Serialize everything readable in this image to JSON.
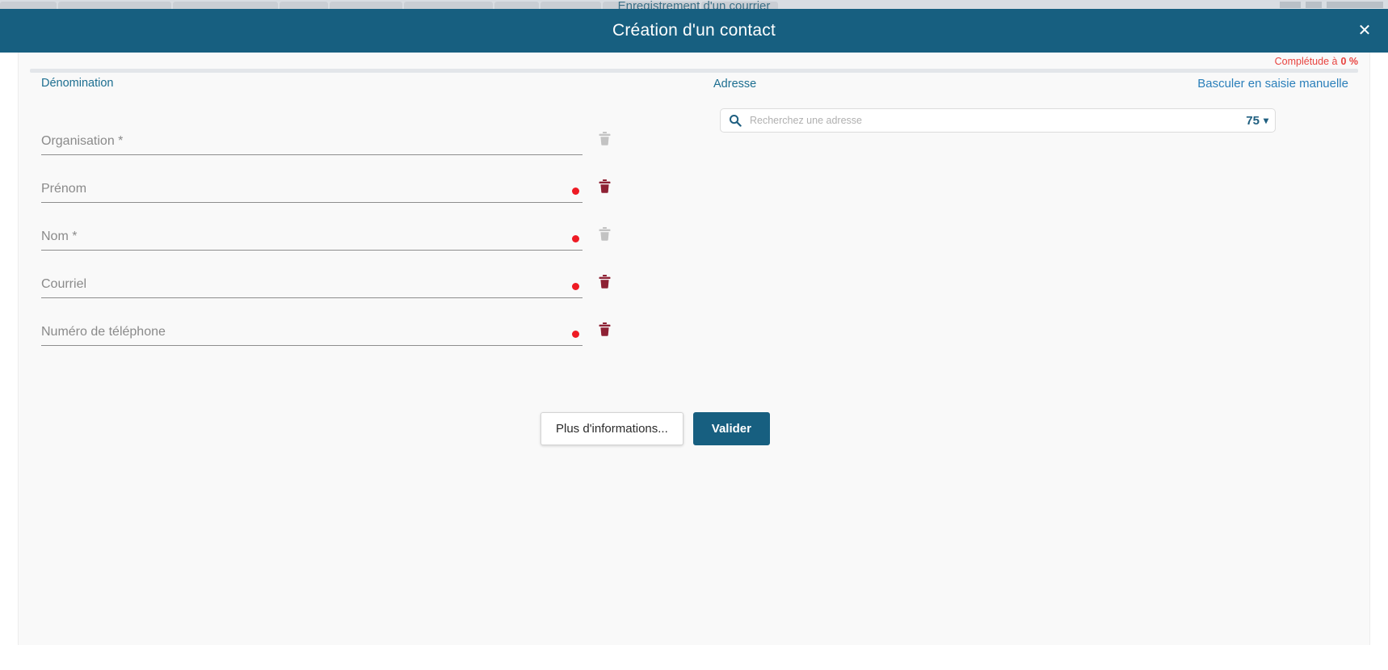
{
  "background": {
    "page_title": "Enregistrement d'un courrier",
    "tab_widths": [
      70,
      140,
      130,
      60,
      90,
      110,
      55,
      75,
      120,
      95
    ],
    "right_chip_widths": [
      26,
      20,
      70
    ]
  },
  "modal": {
    "title": "Création d'un contact",
    "close_icon": "close-icon",
    "close_label": "✕"
  },
  "completeness": {
    "prefix": "Complétude à",
    "value": "0 %",
    "percent": 0,
    "color": "#e8433f"
  },
  "denomination": {
    "section_label": "Dénomination",
    "fields": [
      {
        "placeholder": "Organisation *",
        "value": "",
        "required_dot": false,
        "trash_active": false,
        "name": "organisation"
      },
      {
        "placeholder": "Prénom",
        "value": "",
        "required_dot": true,
        "trash_active": true,
        "name": "prenom"
      },
      {
        "placeholder": "Nom *",
        "value": "",
        "required_dot": true,
        "trash_active": false,
        "name": "nom"
      },
      {
        "placeholder": "Courriel",
        "value": "",
        "required_dot": true,
        "trash_active": true,
        "name": "courriel"
      },
      {
        "placeholder": "Numéro de téléphone",
        "value": "",
        "required_dot": true,
        "trash_active": true,
        "name": "telephone"
      }
    ]
  },
  "actions": {
    "more_info_label": "Plus d'informations...",
    "validate_label": "Valider"
  },
  "adresse": {
    "section_label": "Adresse",
    "toggle_manual_label": "Basculer en saisie manuelle",
    "search_icon": "search-icon",
    "search_placeholder": "Recherchez une adresse",
    "search_value": "",
    "department_value": "75",
    "department_chevron": "chevron-down-icon"
  },
  "colors": {
    "header_blue": "#175f80",
    "link_blue": "#2a7fba",
    "label_blue": "#1c6e90",
    "required_red": "#ee1b24",
    "trash_active": "#8e2134",
    "trash_inactive": "#c3c3c3",
    "body_bg": "#f9f9f9"
  }
}
